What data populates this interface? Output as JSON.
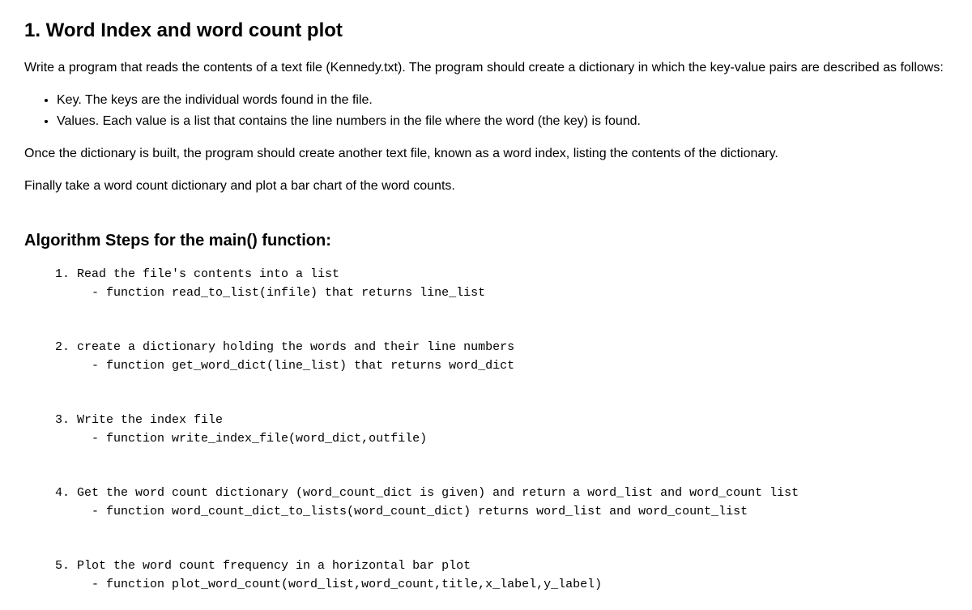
{
  "heading": "1. Word Index and word count plot",
  "intro": "Write a program that reads the contents of a text file (Kennedy.txt). The program should create a dictionary in which the key-value pairs are described as follows:",
  "bullets": [
    "Key. The keys are the individual words found in the file.",
    "Values. Each value is a list that contains the line numbers in the file where the word (the key) is found."
  ],
  "para2": "Once the dictionary is built, the program should create another text file, known as a word index, listing the contents of the dictionary.",
  "para3": "Finally take a word count dictionary and plot a bar chart of the word counts.",
  "subheading": "Algorithm Steps for the main() function:",
  "algorithm": "  1. Read the file's contents into a list\n       - function read_to_list(infile) that returns line_list\n\n\n  2. create a dictionary holding the words and their line numbers\n       - function get_word_dict(line_list) that returns word_dict\n\n\n  3. Write the index file\n       - function write_index_file(word_dict,outfile)\n\n\n  4. Get the word count dictionary (word_count_dict is given) and return a word_list and word_count list\n       - function word_count_dict_to_lists(word_count_dict) returns word_list and word_count_list\n\n\n  5. Plot the word count frequency in a horizontal bar plot\n       - function plot_word_count(word_list,word_count,title,x_label,y_label)"
}
